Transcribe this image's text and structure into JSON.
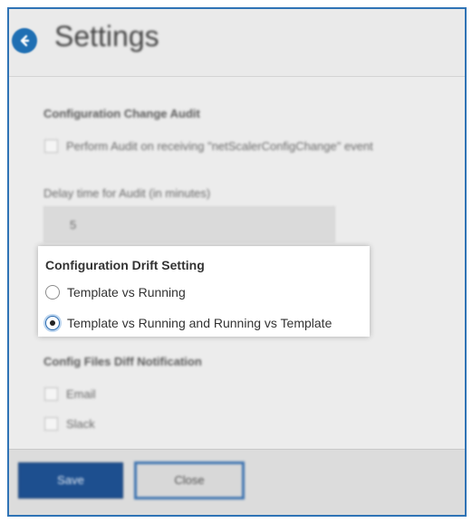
{
  "header": {
    "title": "Settings",
    "back_icon": "arrow-left-circle-icon"
  },
  "config_change_audit": {
    "title": "Configuration Change Audit",
    "perform_audit_label": "Perform Audit on receiving \"netScalerConfigChange\" event",
    "perform_audit_checked": false,
    "delay_label": "Delay time for Audit (in minutes)",
    "delay_value": "5"
  },
  "drift_setting": {
    "title": "Configuration Drift Setting",
    "options": [
      {
        "label": "Template vs Running",
        "selected": false
      },
      {
        "label": "Template vs Running and Running vs Template",
        "selected": true
      }
    ]
  },
  "diff_notification": {
    "title": "Config Files Diff Notification",
    "options": [
      {
        "label": "Email",
        "checked": false
      },
      {
        "label": "Slack",
        "checked": false
      }
    ]
  },
  "footer": {
    "save_label": "Save",
    "close_label": "Close"
  },
  "colors": {
    "accent": "#1f6fb3",
    "save_button": "#1d4f8f",
    "window_border": "#2f73b5"
  }
}
